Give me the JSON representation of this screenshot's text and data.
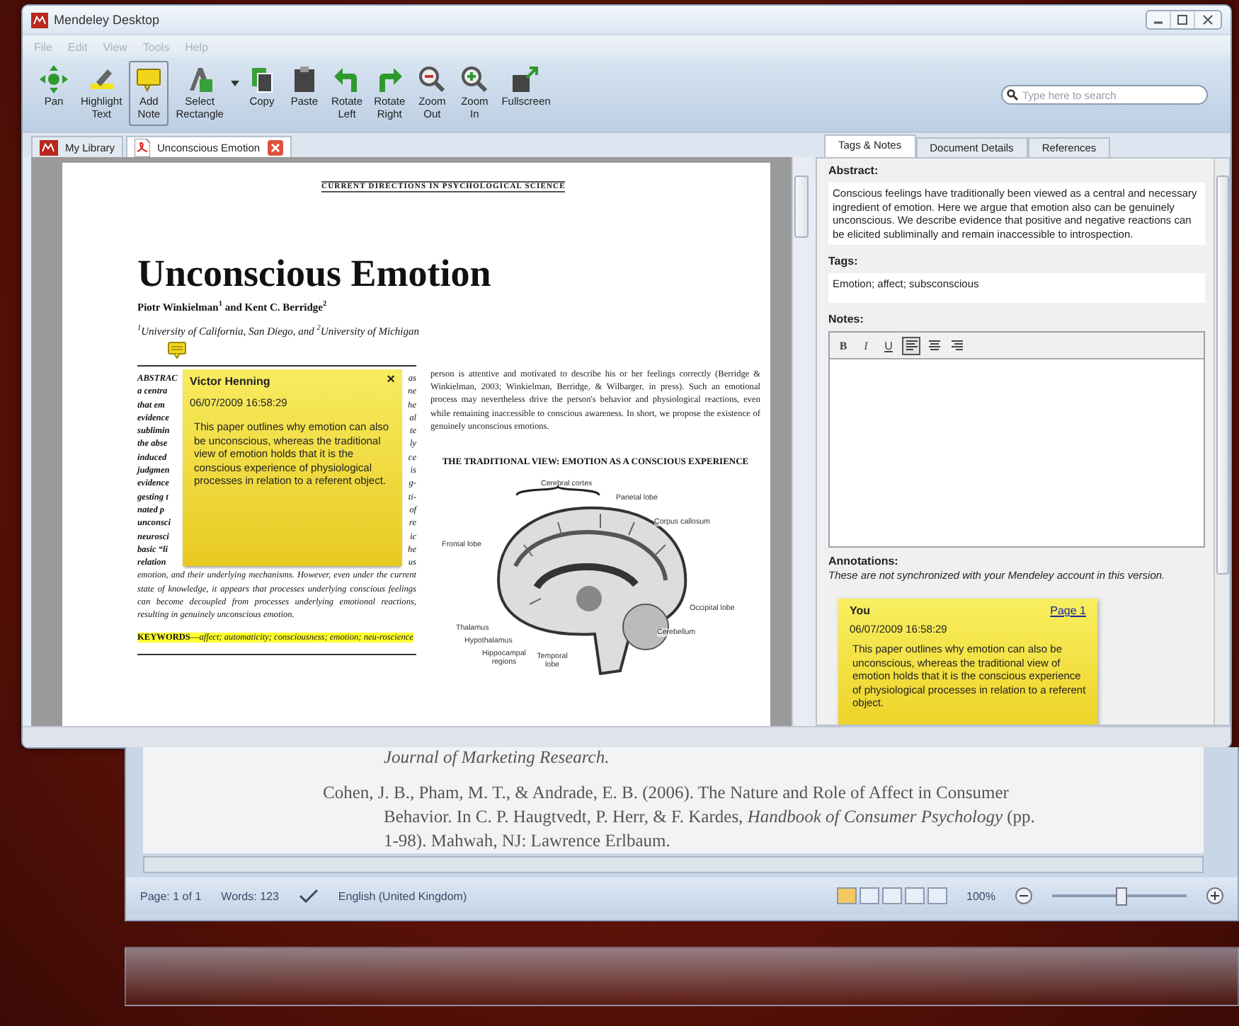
{
  "window": {
    "title": "Mendeley Desktop"
  },
  "menu": [
    {
      "label": "File",
      "disabled": true
    },
    {
      "label": "Edit",
      "disabled": true
    },
    {
      "label": "View",
      "disabled": true
    },
    {
      "label": "Tools",
      "disabled": true
    },
    {
      "label": "Help",
      "disabled": true
    }
  ],
  "toolbar": [
    {
      "kind": "pan",
      "lines": [
        "Pan"
      ],
      "selected": false
    },
    {
      "kind": "highlight",
      "lines": [
        "Highlight",
        "Text"
      ],
      "selected": false
    },
    {
      "kind": "note",
      "lines": [
        "Add",
        "Note"
      ],
      "selected": true
    },
    {
      "kind": "select",
      "lines": [
        "Select",
        "Rectangle"
      ],
      "selected": false
    },
    {
      "kind": "copy",
      "lines": [
        "Copy"
      ],
      "selected": false
    },
    {
      "kind": "paste",
      "lines": [
        "Paste"
      ],
      "selected": false
    },
    {
      "kind": "rotate-left",
      "lines": [
        "Rotate",
        "Left"
      ],
      "selected": false
    },
    {
      "kind": "rotate-right",
      "lines": [
        "Rotate",
        "Right"
      ],
      "selected": false
    },
    {
      "kind": "zoom-out",
      "lines": [
        "Zoom",
        "Out"
      ],
      "selected": false
    },
    {
      "kind": "zoom-in",
      "lines": [
        "Zoom",
        "In"
      ],
      "selected": false
    },
    {
      "kind": "fullscreen",
      "lines": [
        "Fullscreen"
      ],
      "selected": false
    }
  ],
  "search": {
    "placeholder": "Type here to search"
  },
  "doc_tabs": [
    {
      "kind": "library",
      "label": "My Library",
      "selected": false
    },
    {
      "kind": "document",
      "label": "Unconscious Emotion",
      "selected": true
    }
  ],
  "pdf": {
    "journal": "CURRENT DIRECTIONS IN PSYCHOLOGICAL SCIENCE",
    "title": "Unconscious Emotion",
    "authors": "Piotr Winkielman$^{1}$ and Kent C. Berridge$^{2}$",
    "affiliation": "$^{1}$University of California, San Diego, and $^{2}$University of Michigan",
    "abstract_fragments": [
      {
        "left": "ABSTRAC",
        "right": "as"
      },
      {
        "left": "a centra",
        "right": "ne"
      },
      {
        "left": "that em",
        "right": "he"
      },
      {
        "left": "evidence",
        "right": "al"
      },
      {
        "left": "sublimin",
        "right": "te"
      },
      {
        "left": "the abse",
        "right": "ly"
      },
      {
        "left": "induced",
        "right": "ce"
      },
      {
        "left": "judgmen",
        "right": "is"
      },
      {
        "left": "evidence",
        "right": "g-"
      },
      {
        "left": "gesting t",
        "right": "ti-"
      },
      {
        "left": "nated p",
        "right": "of"
      },
      {
        "left": "unconsci",
        "right": "re"
      },
      {
        "left": "neurosci",
        "right": "ic"
      },
      {
        "left": "basic “li",
        "right": "he"
      },
      {
        "left": "relation",
        "right": "us"
      }
    ],
    "abstract_end": "emotion, and their underlying mechanisms. However, even under the current state of knowledge, it appears that processes underlying conscious feelings can become decoupled from processes underlying emotional reactions, resulting in genuinely unconscious emotion.",
    "keywords": "**KEYWORDS**—*affect; automaticity; consciousness; emotion; neu-roscience*",
    "right_paragraph": "person is attentive and motivated to describe his or her feelings correctly (Berridge & Winkielman, 2003; Winkielman, Berridge, & Wilbarger, in press). Such an emotional process may nevertheless drive the person's behavior and physiological reactions, even while remaining inaccessible to conscious awareness. In short, we propose the existence of genuinely unconscious emotions.",
    "figure_title": "THE TRADITIONAL VIEW: EMOTION AS A CONSCIOUS EXPERIENCE",
    "figure_labels": [
      "Cerebral cortex",
      "Parietal lobe",
      "Corpus callosum",
      "Frontal lobe",
      "Occipital lobe",
      "Cerebellum",
      "Thalamus",
      "Hypothalamus",
      "Hippocampal regions",
      "Temporal lobe"
    ],
    "sticky_note": {
      "author": "Victor Henning",
      "date": "06/07/2009 16:58:29",
      "text": "This paper outlines why emotion can also be unconscious, whereas the traditional view of emotion holds that it is the conscious experience of physiological processes in relation to a referent object.",
      "close": "×"
    }
  },
  "side_tabs": [
    {
      "label": "Tags & Notes",
      "selected": true
    },
    {
      "label": "Document Details",
      "selected": false
    },
    {
      "label": "References",
      "selected": false
    }
  ],
  "details": {
    "abstract_label": "Abstract:",
    "abstract": "Conscious feelings have traditionally been viewed as a central and necessary ingredient of emotion. Here we argue that emotion also can be genuinely unconscious. We describe evidence that positive and negative reactions can be elicited subliminally and remain inaccessible to introspection.",
    "tags_label": "Tags:",
    "tags": "Emotion; affect; subsconscious",
    "notes_label": "Notes:",
    "format_buttons": [
      {
        "kind": "bold",
        "label": "B",
        "selected": false
      },
      {
        "kind": "italic",
        "label": "I",
        "selected": false
      },
      {
        "kind": "underline",
        "label": "U",
        "selected": false
      },
      {
        "kind": "align-left",
        "selected": true
      },
      {
        "kind": "align-center",
        "selected": false
      },
      {
        "kind": "align-right",
        "selected": false
      }
    ],
    "annotations_label": "Annotations:",
    "annotations_hint": "These are not synchronized with your Mendeley account in this version.",
    "annotation": {
      "author": "You",
      "page_link": "Page 1",
      "date": "06/07/2009 16:58:29",
      "text": "This paper outlines why emotion can also be unconscious, whereas the traditional view of emotion holds that it is the conscious experience of physiological processes in relation to a referent object."
    }
  },
  "background_window": {
    "reference_end": "Journal of Marketing Research.",
    "reference": "Cohen, J. B., Pham, M. T., & Andrade, E. B. (2006). The Nature and Role of Affect in Consumer Behavior. In C. P. Haugtvedt, P. Herr, & F. Kardes, *Handbook of Consumer Psychology* (pp. 1-98). Mahwah, NJ: Lawrence Erlbaum.",
    "status": {
      "page": "Page: 1 of 1",
      "words": "Words: 123",
      "language": "English (United Kingdom)",
      "zoom": "100%",
      "zoom_slider": {
        "level": 0.5
      }
    }
  }
}
